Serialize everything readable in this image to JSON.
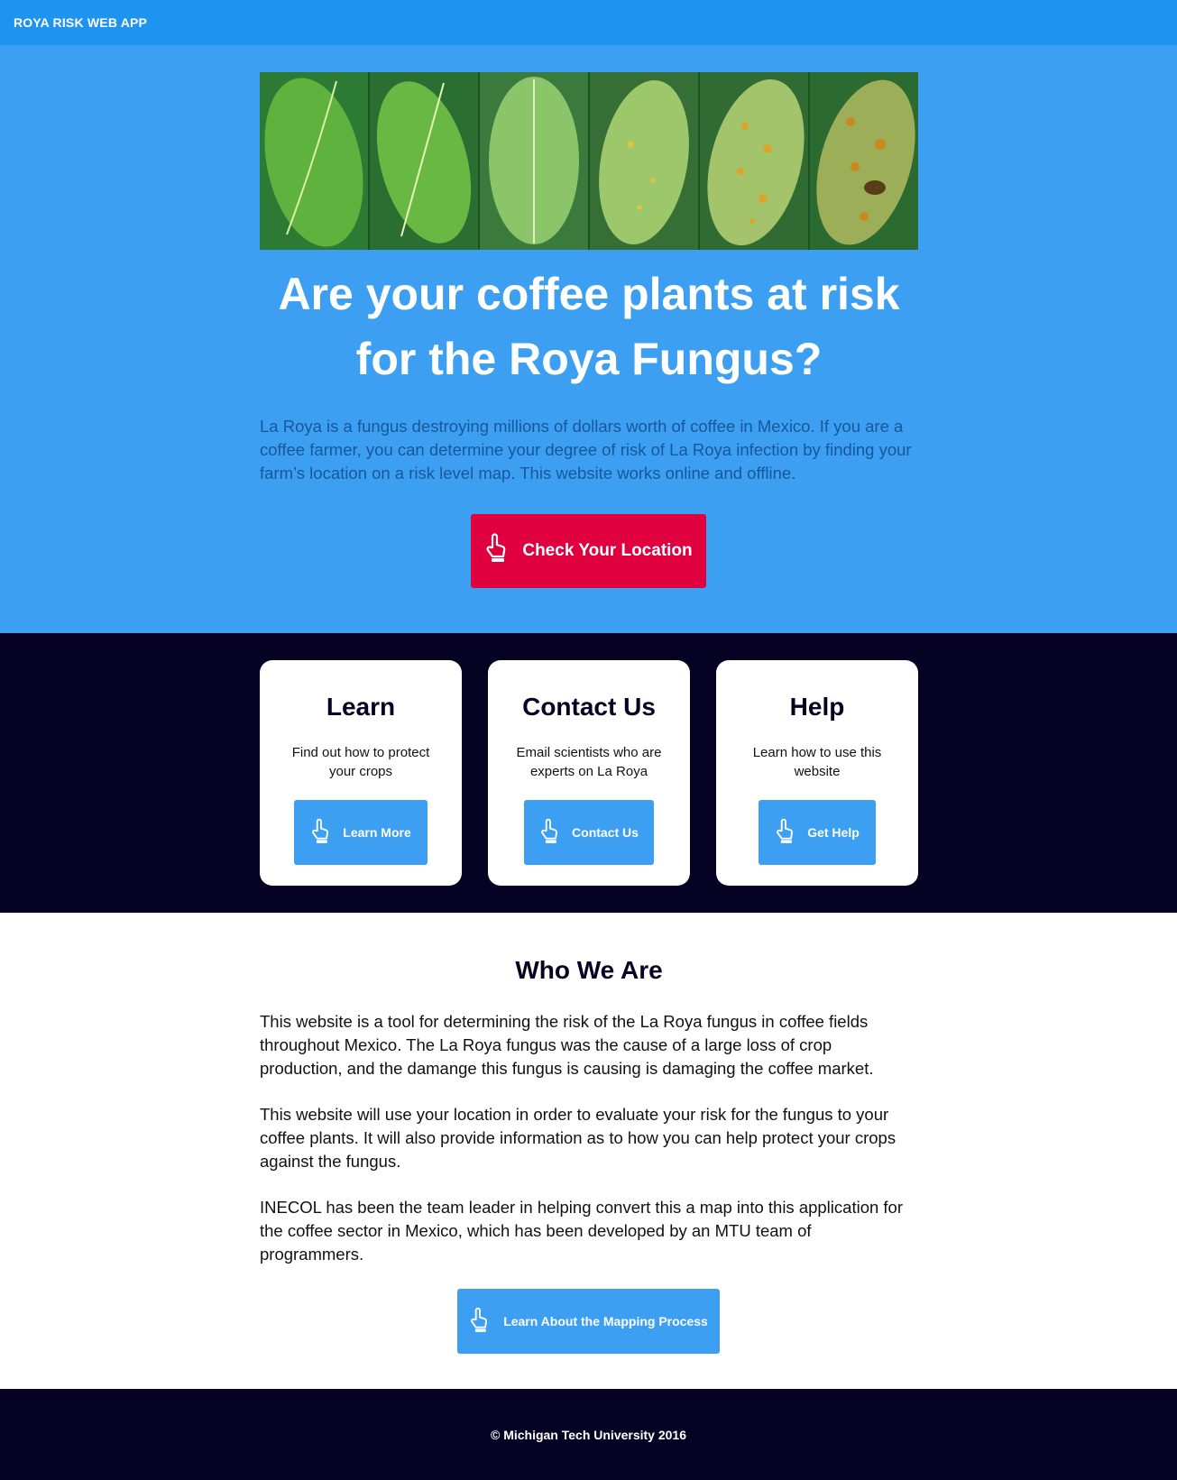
{
  "navbar": {
    "brand": "ROYA RISK WEB APP"
  },
  "hero": {
    "title": "Are your coffee plants at risk for the Roya Fungus?",
    "description": "La Roya is a fungus destroying millions of dollars worth of coffee in Mexico. If you are a coffee farmer, you can determine your degree of risk of La Roya infection by finding your farm’s location on a risk level map. This website works online and offline.",
    "button_label": "Check Your Location",
    "button_icon": "pointing-hand-icon",
    "banner_icon": "coffee-leaves-infection-stages-image"
  },
  "cards": [
    {
      "title": "Learn",
      "description": "Find out how to protect your crops",
      "button_label": "Learn More"
    },
    {
      "title": "Contact Us",
      "description": "Email scientists who are experts on La Roya",
      "button_label": "Contact Us"
    },
    {
      "title": "Help",
      "description": "Learn how to use this website",
      "button_label": "Get Help"
    }
  ],
  "who": {
    "title": "Who We Are",
    "paragraphs": [
      "This website is a tool for determining the risk of the La Roya fungus in coffee fields throughout Mexico. The La Roya fungus was the cause of a large loss of crop production, and the damange this fungus is causing is damaging the coffee market.",
      "This website will use your location in order to evaluate your risk for the fungus to your coffee plants. It will also provide information as to how you can help protect your crops against the fungus.",
      "INECOL has been the team leader in helping convert this a map into this application for the coffee sector in Mexico, which has been developed by an MTU team of programmers."
    ],
    "button_label": "Learn About the Mapping Process"
  },
  "footer": {
    "text": "© Michigan Tech University 2016"
  },
  "colors": {
    "navbar": "#1e94ef",
    "hero_bg": "#3c9ff2",
    "check_button": "#e0003f",
    "dark_bg": "#050223",
    "hero_text": "#18579a"
  }
}
